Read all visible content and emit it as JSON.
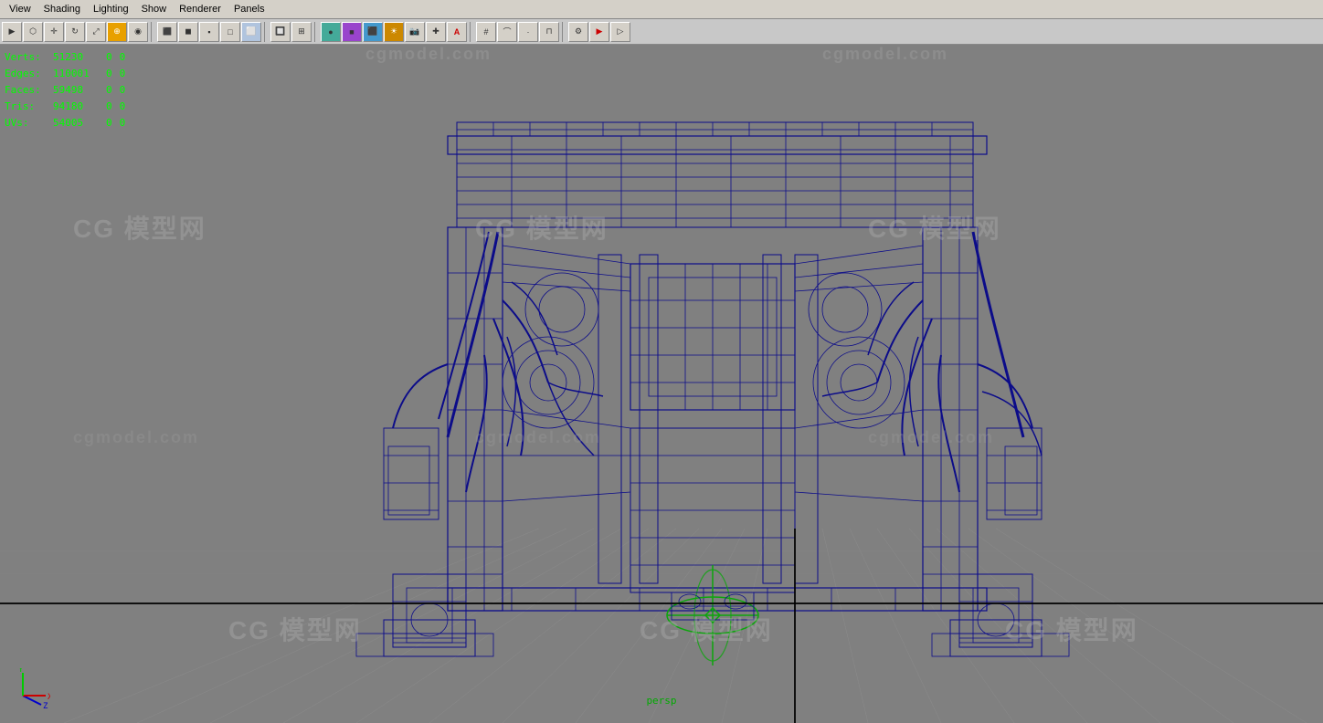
{
  "menu": {
    "items": [
      "View",
      "Shading",
      "Lighting",
      "Show",
      "Renderer",
      "Panels"
    ]
  },
  "toolbar": {
    "buttons": [
      "select",
      "move",
      "rotate",
      "scale",
      "softmod",
      "snap",
      "camera",
      "shading1",
      "shading2",
      "shading3",
      "shading4",
      "shading5",
      "shading6",
      "shading7",
      "light1",
      "light2",
      "light3",
      "show1",
      "show2",
      "show3",
      "resolution",
      "render1",
      "render2",
      "render3",
      "sep",
      "panels1",
      "panels2"
    ]
  },
  "stats": {
    "verts": {
      "label": "Verts:",
      "val": "51230",
      "a": "0",
      "b": "0"
    },
    "edges": {
      "label": "Edges:",
      "val": "110001",
      "a": "0",
      "b": "0"
    },
    "faces": {
      "label": "Faces:",
      "val": "59498",
      "a": "0",
      "b": "0"
    },
    "tris": {
      "label": "Tris:",
      "val": "94180",
      "a": "0",
      "b": "0"
    },
    "uvs": {
      "label": "UVs:",
      "val": "54005",
      "a": "0",
      "b": "0"
    }
  },
  "watermarks": [
    "CG 模型网",
    "cgmodel.com",
    "CG 模型网",
    "cgmodel.com",
    "CG 模型网",
    "cgmodel.com",
    "CG 模型网"
  ],
  "viewport": {
    "persp_label": "persp",
    "bg_color": "#808080"
  },
  "axis": {
    "x_color": "#ff0000",
    "y_color": "#00ff00",
    "z_color": "#0000ff"
  }
}
